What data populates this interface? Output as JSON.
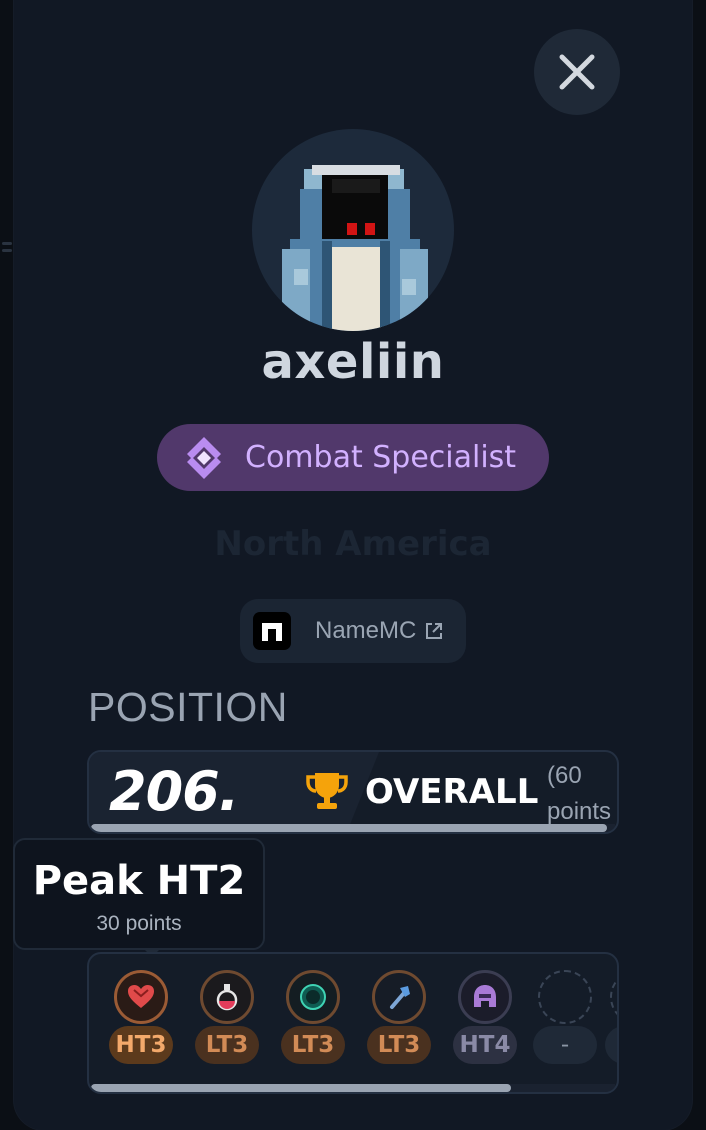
{
  "profile": {
    "username": "axeliin",
    "badge_label": "Combat Specialist",
    "region": "North America",
    "namemc_label": "NameMC"
  },
  "position": {
    "heading": "POSITION",
    "rank": "206.",
    "category": "OVERALL",
    "points": "(60 points"
  },
  "tooltip": {
    "title": "Peak HT2",
    "subtitle": "30 points"
  },
  "tiers": [
    {
      "icon": "heart-icon",
      "label": "HT3"
    },
    {
      "icon": "potion-icon",
      "label": "LT3"
    },
    {
      "icon": "ender-pearl-icon",
      "label": "LT3"
    },
    {
      "icon": "axe-icon",
      "label": "LT3"
    },
    {
      "icon": "helmet-icon",
      "label": "HT4"
    },
    {
      "icon": "empty-slot-icon",
      "label": "-"
    }
  ],
  "colors": {
    "background": "#0b0f15",
    "modal": "#111824",
    "badge_bg": "#51386b",
    "badge_text": "#d2b1ff",
    "ht3_pill": "#5c3a1c",
    "ht3_text": "#f3a96b",
    "lt3_pill": "#4a311f",
    "lt3_text": "#d28b56",
    "ht4_pill": "#2d3142",
    "ht4_text": "#8a8aa6"
  }
}
